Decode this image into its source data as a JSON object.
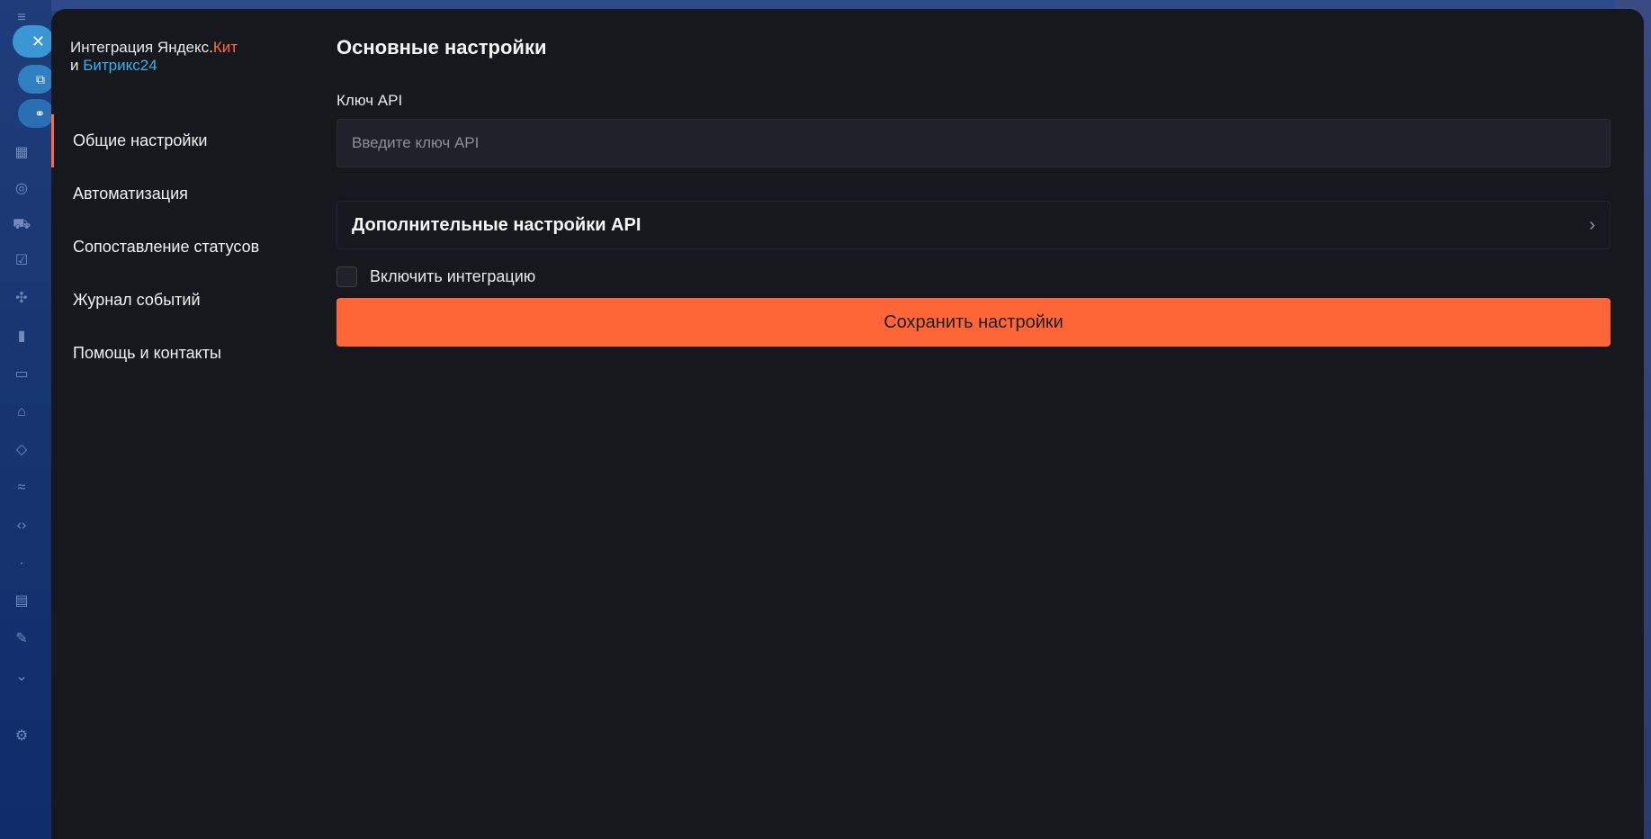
{
  "app": {
    "brand_line1_prefix": "Интеграция Яндекс.",
    "brand_line1_accent": "Кит",
    "brand_line2_prefix": "и ",
    "brand_line2_accent": "Битрикс24",
    "accent_orange": "#ff6a3d",
    "accent_blue": "#2fb5f0"
  },
  "floating_buttons": {
    "close_icon": "close-icon",
    "open_icon": "external-link-icon",
    "link_icon": "link-icon"
  },
  "sidebar": {
    "items": [
      {
        "label": "Общие настройки",
        "active": true
      },
      {
        "label": "Автоматизация",
        "active": false
      },
      {
        "label": "Сопоставление статусов",
        "active": false
      },
      {
        "label": "Журнал событий",
        "active": false
      },
      {
        "label": "Помощь и контакты",
        "active": false
      }
    ]
  },
  "main": {
    "title": "Основные настройки",
    "api_key_label": "Ключ API",
    "api_key_placeholder": "Введите ключ API",
    "api_key_value": "",
    "advanced_title": "Дополнительные настройки API",
    "enable_label": "Включить интеграцию",
    "enable_checked": false,
    "save_label": "Сохранить настройки",
    "save_color": "#ff6637"
  }
}
